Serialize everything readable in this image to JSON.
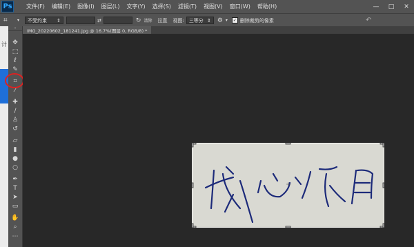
{
  "app": {
    "logo": "Ps"
  },
  "menu": [
    "文件(F)",
    "编辑(E)",
    "图像(I)",
    "图层(L)",
    "文字(Y)",
    "选择(S)",
    "滤镜(T)",
    "视图(V)",
    "窗口(W)",
    "帮助(H)"
  ],
  "window_controls": [
    "—",
    "□",
    "✕"
  ],
  "options": {
    "ratio_select": "不受约束",
    "clear_label": "清除",
    "straighten_label": "拉直",
    "view_label": "视图:",
    "view_select": "三等分",
    "delete_cropped_label": "删除裁剪的像素",
    "delete_cropped_checked": true
  },
  "document": {
    "tab_title": "IMG_20220602_181241.jpg @ 16.7%(图层 0, RGB/8) *"
  },
  "left_strip_char": "计",
  "tools": [
    "move",
    "marquee",
    "lasso",
    "quick-select",
    "crop",
    "eyedropper",
    "healing",
    "brush",
    "clone",
    "history-brush",
    "eraser",
    "gradient",
    "blur",
    "dodge",
    "pen",
    "type",
    "path-select",
    "shape",
    "hand",
    "zoom"
  ]
}
